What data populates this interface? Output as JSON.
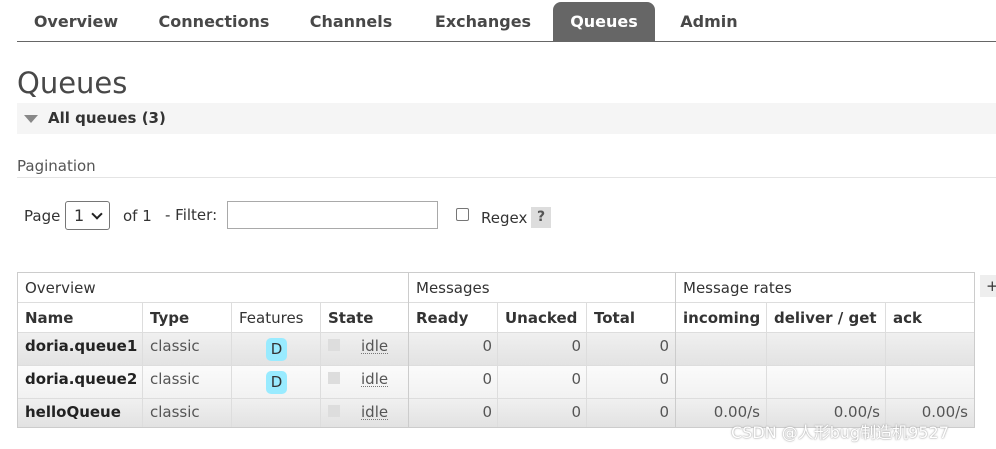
{
  "nav": {
    "tabs": [
      {
        "label": "Overview",
        "active": false
      },
      {
        "label": "Connections",
        "active": false
      },
      {
        "label": "Channels",
        "active": false
      },
      {
        "label": "Exchanges",
        "active": false
      },
      {
        "label": "Queues",
        "active": true
      },
      {
        "label": "Admin",
        "active": false
      }
    ]
  },
  "page": {
    "title": "Queues"
  },
  "section": {
    "label": "All queues (3)"
  },
  "pagination": {
    "label": "Pagination",
    "page_label": "Page",
    "page_value": "1",
    "of_label": "of 1",
    "filter_label": "- Filter:",
    "filter_value": "",
    "regex_label": "Regex",
    "help_label": "?"
  },
  "table": {
    "groups": [
      "Overview",
      "Messages",
      "Message rates"
    ],
    "headers": [
      "Name",
      "Type",
      "Features",
      "State",
      "Ready",
      "Unacked",
      "Total",
      "incoming",
      "deliver / get",
      "ack"
    ],
    "add_column_label": "+",
    "rows": [
      {
        "name": "doria.queue1",
        "type": "classic",
        "feature": "D",
        "state": "idle",
        "ready": "0",
        "unacked": "0",
        "total": "0",
        "incoming": "",
        "deliver": "",
        "ack": ""
      },
      {
        "name": "doria.queue2",
        "type": "classic",
        "feature": "D",
        "state": "idle",
        "ready": "0",
        "unacked": "0",
        "total": "0",
        "incoming": "",
        "deliver": "",
        "ack": ""
      },
      {
        "name": "helloQueue",
        "type": "classic",
        "feature": "",
        "state": "idle",
        "ready": "0",
        "unacked": "0",
        "total": "0",
        "incoming": "0.00/s",
        "deliver": "0.00/s",
        "ack": "0.00/s"
      }
    ]
  },
  "watermark": "CSDN @人形bug制造机9527",
  "colors": {
    "active_tab": "#666666",
    "feature_badge": "#99ebff",
    "row_shade": "#e8e8e8"
  }
}
